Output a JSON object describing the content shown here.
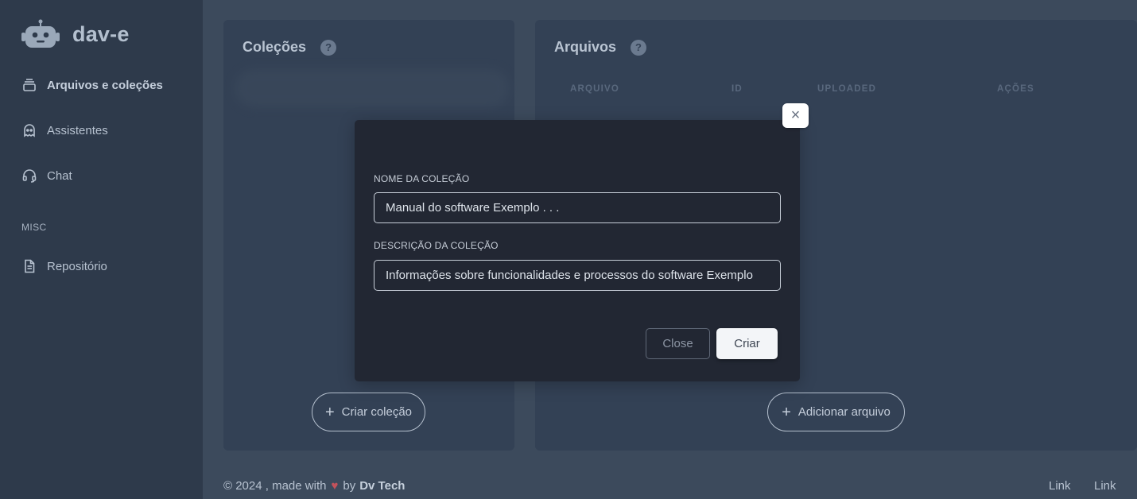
{
  "app": {
    "name": "dav-e"
  },
  "sidebar": {
    "items": [
      {
        "label": "Arquivos e coleções",
        "icon": "layers-icon",
        "active": true
      },
      {
        "label": "Assistentes",
        "icon": "ghost-icon"
      },
      {
        "label": "Chat",
        "icon": "headset-icon"
      }
    ],
    "misc_label": "MISC",
    "misc_items": [
      {
        "label": "Repositório",
        "icon": "document-icon"
      }
    ]
  },
  "colecoes": {
    "title": "Coleções",
    "help": "?",
    "create_button": "Criar coleção"
  },
  "arquivos": {
    "title": "Arquivos",
    "help": "?",
    "columns": [
      "ARQUIVO",
      "ID",
      "UPLOADED",
      "AÇÕES"
    ],
    "add_button": "Adicionar arquivo"
  },
  "common": {
    "plus": "+"
  },
  "modal": {
    "close_icon": "×",
    "name_label": "NOME DA COLEÇÃO",
    "name_value": "Manual do software Exemplo . . .",
    "description_label": "DESCRIÇÃO DA COLEÇÃO",
    "description_value": "Informações sobre funcionalidades e processos do software Exemplo",
    "close_button": "Close",
    "create_button": "Criar"
  },
  "footer": {
    "copyright": "© 2024 , made with",
    "heart": "♥",
    "by": "by",
    "author": "Dv Tech",
    "links": [
      "Link",
      "Link"
    ]
  },
  "colors": {
    "sidebar_bg": "#2e3a4b",
    "page_bg": "#3c4a5c",
    "card_bg": "#334155",
    "modal_bg": "#222733",
    "heart": "#c2525b"
  }
}
